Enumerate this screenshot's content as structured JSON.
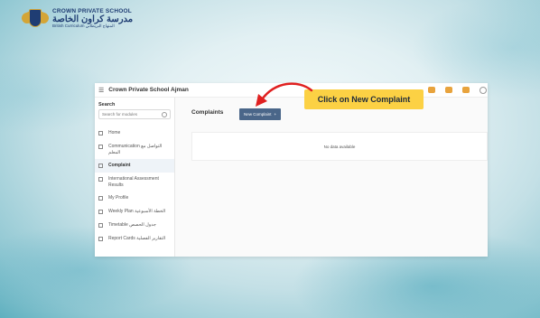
{
  "logo": {
    "name_en": "CROWN PRIVATE SCHOOL",
    "name_ar": "مدرسة كراون الخاصة",
    "subtitle": "British Curriculum المنهاج البريطاني"
  },
  "app": {
    "title": "Crown Private School Ajman"
  },
  "sidebar": {
    "search_label": "Search",
    "search_placeholder": "Search for modules",
    "items": [
      {
        "label": "Home",
        "active": false
      },
      {
        "label": "Communication التواصل مع المعلم",
        "active": false
      },
      {
        "label": "Complaint",
        "active": true
      },
      {
        "label": "International Assessment Results",
        "active": false
      },
      {
        "label": "My Profile",
        "active": false
      },
      {
        "label": "Weekly Plan الخطة الأسبوعية",
        "active": false
      },
      {
        "label": "Timetable جدول الحصص",
        "active": false
      },
      {
        "label": "Report Cards التقارير الفصلية",
        "active": false
      }
    ]
  },
  "main": {
    "title": "Complaints",
    "new_button_label": "New Complaint",
    "new_button_icon": "+",
    "empty_text": "No data available"
  },
  "annotation": {
    "text": "Click on New Complaint",
    "color": "#fcd144",
    "arrow_color": "#e02020"
  },
  "colors": {
    "button": "#4a6689",
    "top_icon": "#e8a33d"
  }
}
